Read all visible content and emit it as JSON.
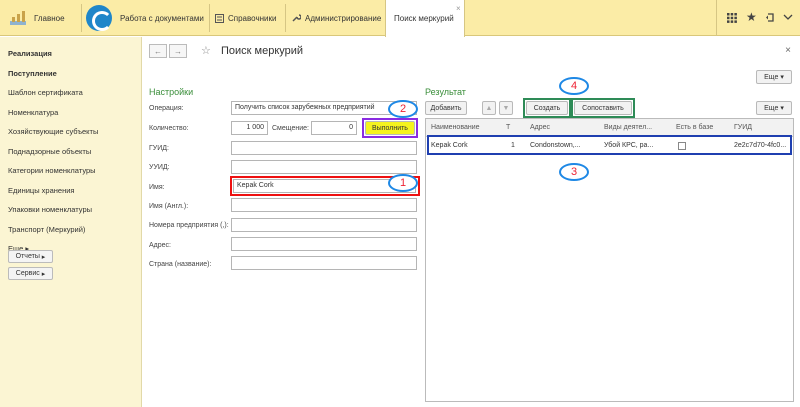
{
  "topbar": {
    "home_label": "Главное",
    "menu": [
      "Работа с документами",
      "Справочники",
      "Администрирование"
    ],
    "active_tab": "Поиск меркурий"
  },
  "sidebar": {
    "items": [
      "Реализация",
      "Поступление",
      "Шаблон сертификата",
      "Номенклатура",
      "Хозяйствующие субъекты",
      "Поднадзорные объекты",
      "Категории номенклатуры",
      "Единицы хранения",
      "Упаковки номенклатуры",
      "Транспорт (Меркурий)",
      "Еще"
    ],
    "buttons": [
      "Отчеты",
      "Сервис"
    ]
  },
  "page": {
    "title": "Поиск меркурий",
    "more_label": "Еще"
  },
  "settings": {
    "title": "Настройки",
    "operation_label": "Операция:",
    "operation_value": "Получить список зарубежных предприятий",
    "quantity_label": "Количество:",
    "quantity_value": "1 000",
    "offset_label": "Смещение:",
    "offset_value": "0",
    "execute_button": "Выполнить",
    "guid_label": "ГУИД:",
    "uuid_label": "УУИД:",
    "name_label": "Имя:",
    "name_value": "Kepak Cork",
    "name_en_label": "Имя (Англ.):",
    "enterprise_numbers_label": "Номера предприятия (,):",
    "address_label": "Адрес:",
    "country_label": "Страна (название):"
  },
  "result": {
    "title": "Результат",
    "add_button": "Добавить",
    "create_button": "Создать",
    "match_button": "Сопоставить",
    "more_label": "Еще",
    "columns": [
      "Наименование",
      "Т",
      "Адрес",
      "Виды деятел...",
      "Есть в базе",
      "ГУИД"
    ],
    "rows": [
      {
        "name": "Kepak Cork",
        "t": "1",
        "address": "Condonstown,...",
        "activity": "Убой КРС, ра...",
        "in_base": false,
        "guid": "2e2c7d70-4fc0..."
      }
    ]
  },
  "annotations": [
    "1",
    "2",
    "3",
    "4"
  ]
}
